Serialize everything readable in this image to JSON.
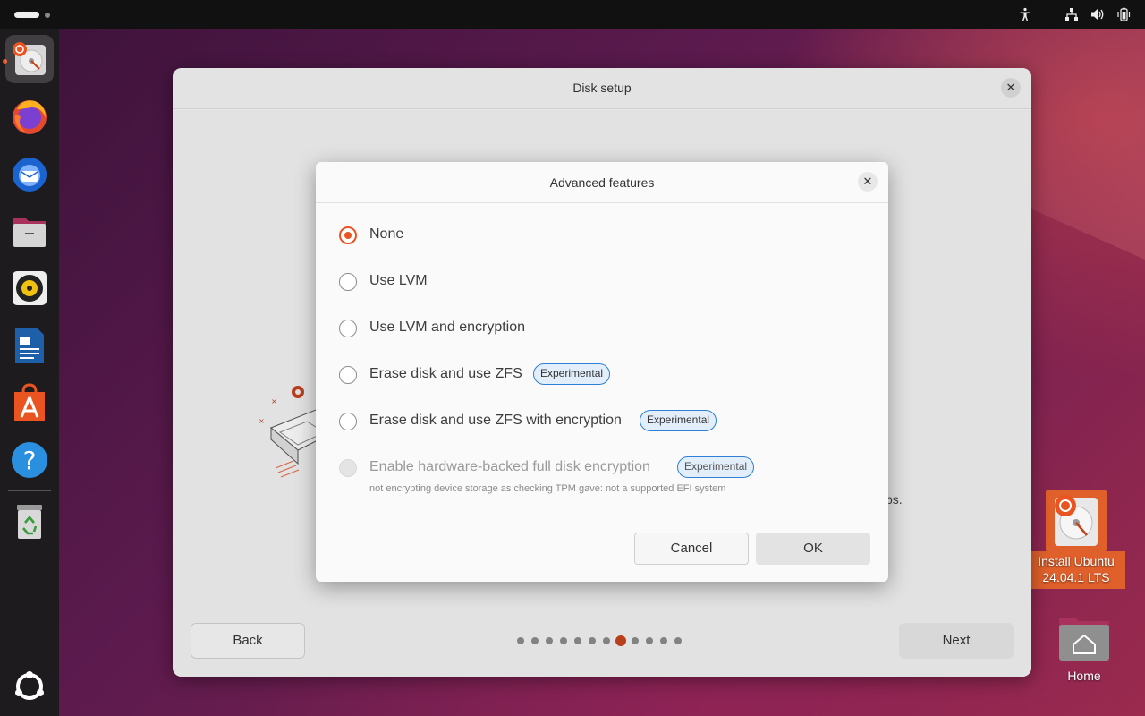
{
  "system": {
    "tray_icons": [
      "accessibility-icon",
      "network-icon",
      "volume-icon",
      "battery-icon"
    ],
    "accent_color": "#e95420"
  },
  "dock": {
    "apps": [
      {
        "name": "ubuntu-installer-icon",
        "active": true
      },
      {
        "name": "firefox-icon",
        "active": false
      },
      {
        "name": "thunderbird-icon",
        "active": false
      },
      {
        "name": "files-icon",
        "active": false
      },
      {
        "name": "rhythmbox-icon",
        "active": false
      },
      {
        "name": "libreoffice-writer-icon",
        "active": false
      },
      {
        "name": "app-center-icon",
        "active": false
      },
      {
        "name": "help-icon",
        "active": false
      },
      {
        "name": "trash-icon",
        "active": false
      }
    ],
    "show_apps_icon": "show-applications-icon"
  },
  "desktop": {
    "install_label_line1": "Install Ubuntu",
    "install_label_line2": "24.04.1 LTS",
    "home_label": "Home"
  },
  "installer": {
    "title": "Disk setup",
    "partial_text": "ps.",
    "back_label": "Back",
    "next_label": "Next",
    "steps_total": 12,
    "current_step": 8
  },
  "modal": {
    "title": "Advanced features",
    "options": [
      {
        "label": "None",
        "selected": true,
        "disabled": false,
        "badge": ""
      },
      {
        "label": "Use LVM",
        "selected": false,
        "disabled": false,
        "badge": ""
      },
      {
        "label": "Use LVM and encryption",
        "selected": false,
        "disabled": false,
        "badge": ""
      },
      {
        "label": "Erase disk and use ZFS",
        "selected": false,
        "disabled": false,
        "badge": "Experimental"
      },
      {
        "label": "Erase disk and use ZFS with encryption",
        "selected": false,
        "disabled": false,
        "badge": "Experimental"
      },
      {
        "label": "Enable hardware-backed full disk encryption",
        "selected": false,
        "disabled": true,
        "badge": "Experimental"
      }
    ],
    "hint": "not encrypting device storage as checking TPM gave: not a supported EFI system",
    "cancel_label": "Cancel",
    "ok_label": "OK"
  }
}
